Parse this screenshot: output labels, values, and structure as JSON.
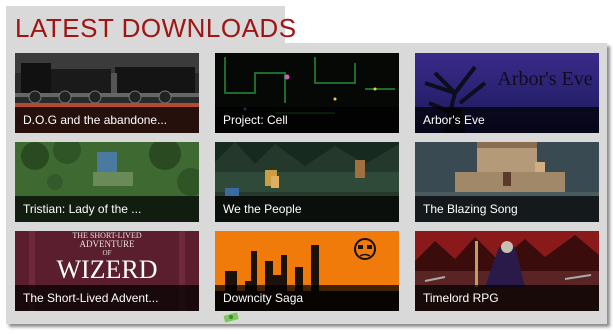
{
  "header": {
    "title": "LATEST DOWNLOADS"
  },
  "colors": {
    "title": "#a01414",
    "panel": "#d9d9d9",
    "caption_bg": "#000000"
  },
  "downloads": [
    {
      "title": "D.O.G and the abandone..."
    },
    {
      "title": "Project: Cell"
    },
    {
      "title": "Arbor's Eve",
      "art_text": "Arbor's Eve"
    },
    {
      "title": "Tristian: Lady of the ..."
    },
    {
      "title": "We the People"
    },
    {
      "title": "The Blazing Song"
    },
    {
      "title": "The Short-Lived Advent...",
      "art_text": [
        "THE SHORT-LIVED",
        "ADVENTURE",
        "OF",
        "WIZERD"
      ]
    },
    {
      "title": "Downcity Saga"
    },
    {
      "title": "Timelord RPG"
    }
  ]
}
